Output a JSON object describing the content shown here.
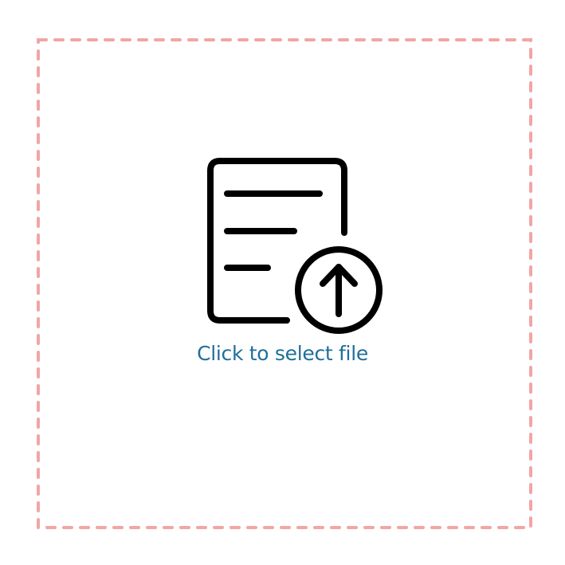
{
  "dropzone": {
    "label": "Click to select file",
    "icon": "file-upload-icon",
    "border_color": "#f2a5a5",
    "label_color": "#1f6f99",
    "icon_color": "#000000"
  }
}
